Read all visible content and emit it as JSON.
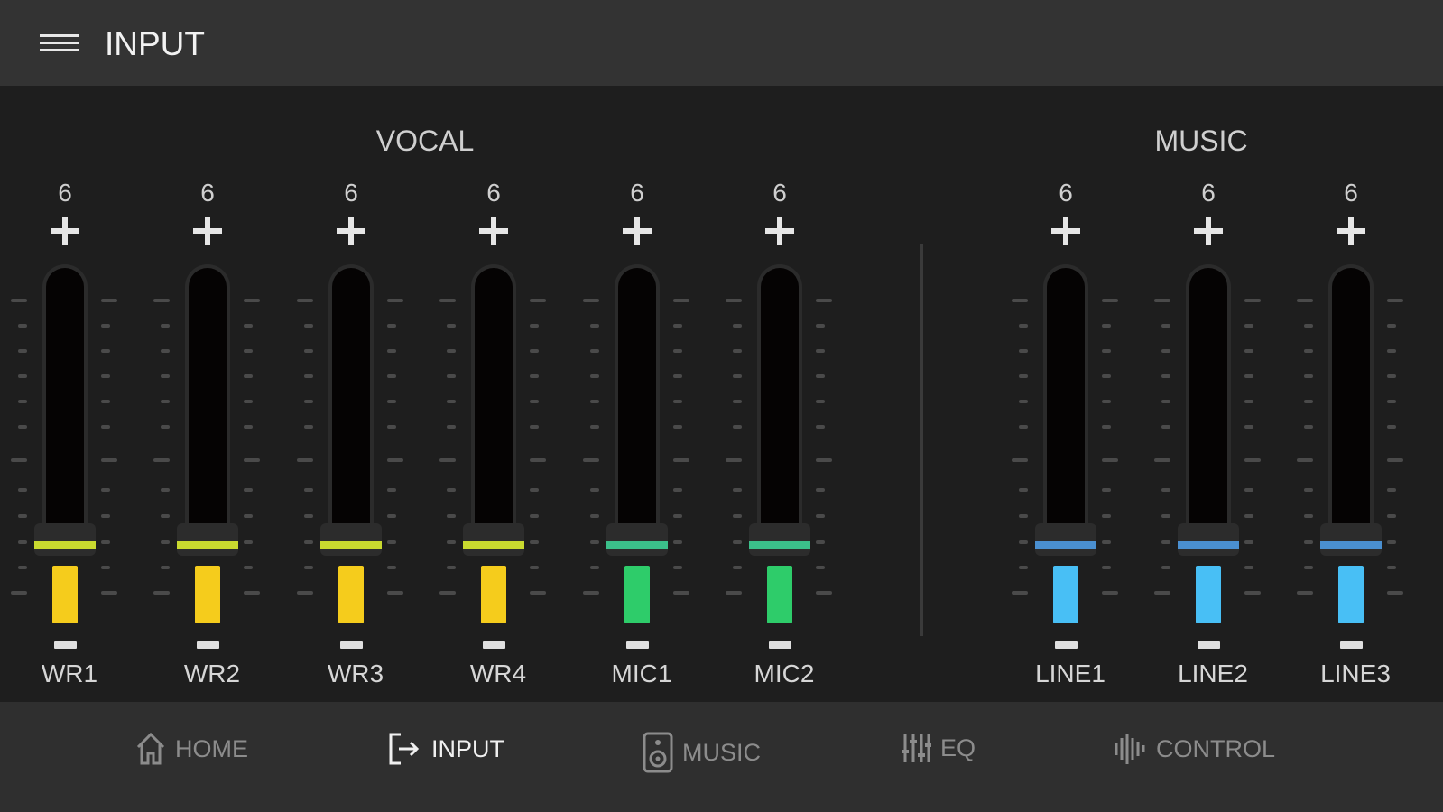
{
  "header": {
    "title": "INPUT",
    "menu_icon": "hamburger-icon"
  },
  "groups": [
    {
      "title": "VOCAL"
    },
    {
      "title": "MUSIC"
    }
  ],
  "channels": [
    {
      "label": "WR1",
      "gain": "6",
      "group": "VOCAL",
      "color": "#f5cc1c",
      "indicator": "#c9d92f",
      "fader_position": 0.05
    },
    {
      "label": "WR2",
      "gain": "6",
      "group": "VOCAL",
      "color": "#f5cc1c",
      "indicator": "#c9d92f",
      "fader_position": 0.05
    },
    {
      "label": "WR3",
      "gain": "6",
      "group": "VOCAL",
      "color": "#f5cc1c",
      "indicator": "#c9d92f",
      "fader_position": 0.05
    },
    {
      "label": "WR4",
      "gain": "6",
      "group": "VOCAL",
      "color": "#f5cc1c",
      "indicator": "#c9d92f",
      "fader_position": 0.05
    },
    {
      "label": "MIC1",
      "gain": "6",
      "group": "VOCAL",
      "color": "#2ecc6a",
      "indicator": "#3bbf8a",
      "fader_position": 0.05
    },
    {
      "label": "MIC2",
      "gain": "6",
      "group": "VOCAL",
      "color": "#2ecc6a",
      "indicator": "#3bbf8a",
      "fader_position": 0.05
    },
    {
      "label": "LINE1",
      "gain": "6",
      "group": "MUSIC",
      "color": "#48bff5",
      "indicator": "#4a8fd0",
      "fader_position": 0.05
    },
    {
      "label": "LINE2",
      "gain": "6",
      "group": "MUSIC",
      "color": "#48bff5",
      "indicator": "#4a8fd0",
      "fader_position": 0.05
    },
    {
      "label": "LINE3",
      "gain": "6",
      "group": "MUSIC",
      "color": "#48bff5",
      "indicator": "#4a8fd0",
      "fader_position": 0.05
    }
  ],
  "nav": [
    {
      "label": "HOME",
      "icon": "home-icon",
      "active": false
    },
    {
      "label": "INPUT",
      "icon": "input-icon",
      "active": true
    },
    {
      "label": "MUSIC",
      "icon": "speaker-icon",
      "active": false
    },
    {
      "label": "EQ",
      "icon": "equalizer-icon",
      "active": false
    },
    {
      "label": "CONTROL",
      "icon": "waveform-icon",
      "active": false
    }
  ]
}
